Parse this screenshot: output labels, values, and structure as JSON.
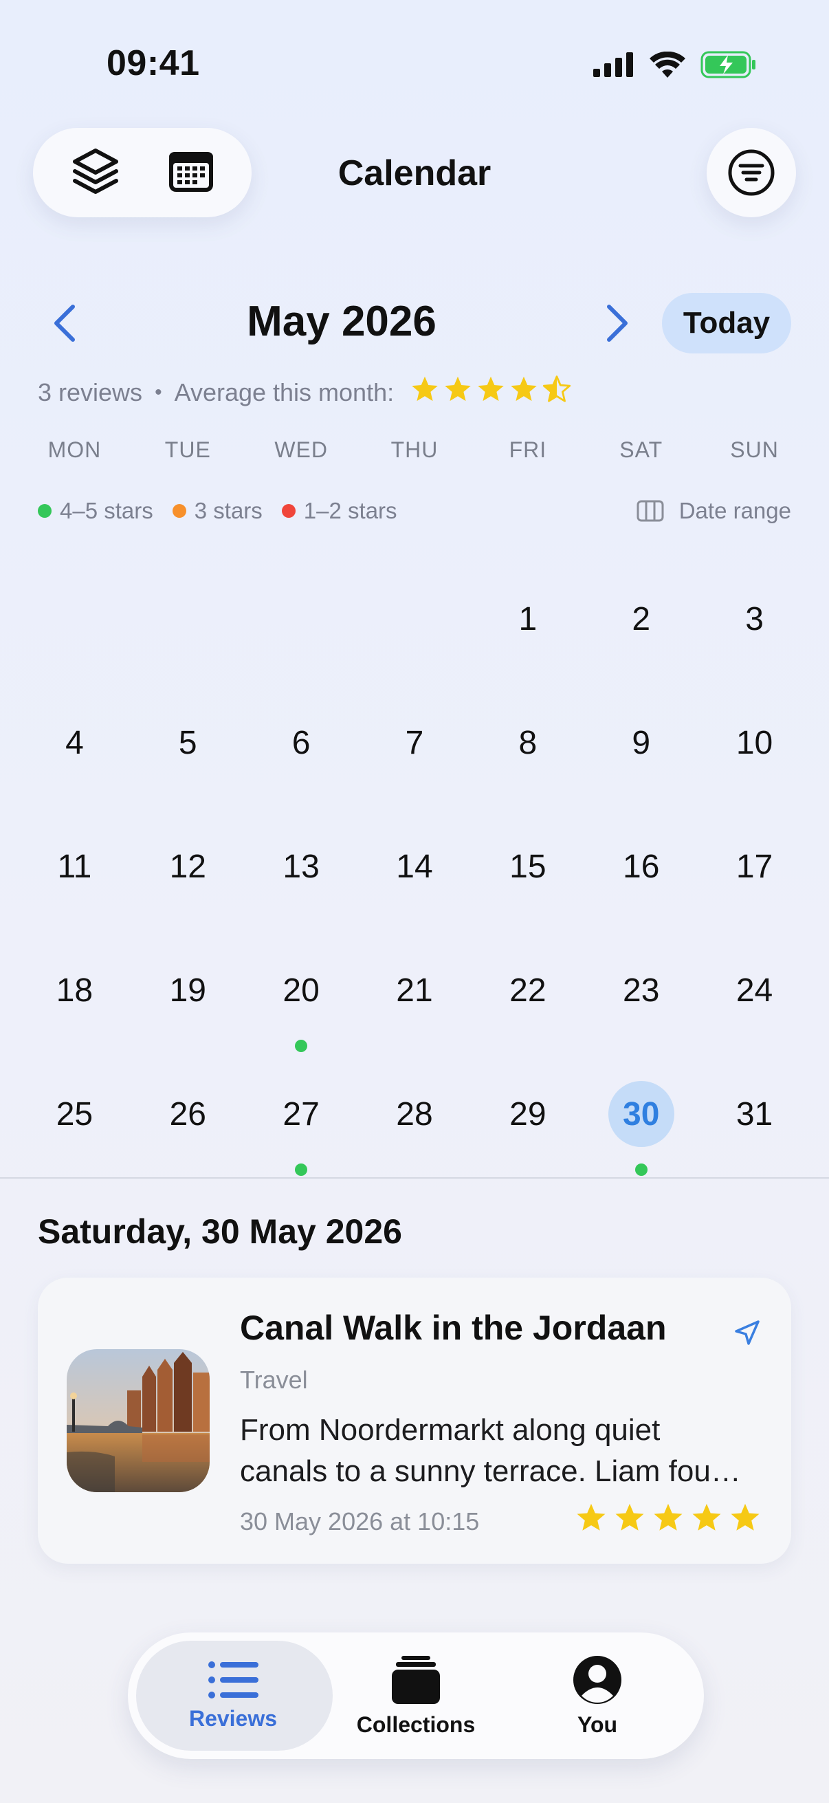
{
  "status_bar": {
    "time": "09:41"
  },
  "header": {
    "title": "Calendar",
    "left_icons": [
      "layers-icon",
      "calendar-icon"
    ],
    "right_icon": "filter-icon"
  },
  "month_nav": {
    "month_label": "May 2026",
    "today_label": "Today"
  },
  "summary": {
    "reviews_count": "3 reviews",
    "separator": "•",
    "average_label": "Average this month:",
    "average_rating": 4.5
  },
  "weekdays": [
    "MON",
    "TUE",
    "WED",
    "THU",
    "FRI",
    "SAT",
    "SUN"
  ],
  "legend": {
    "items": [
      {
        "label": "4–5 stars",
        "color": "#34c759"
      },
      {
        "label": "3 stars",
        "color": "#f7902b"
      },
      {
        "label": "1–2 stars",
        "color": "#f0453a"
      }
    ],
    "date_range_label": "Date range"
  },
  "calendar": {
    "leading_blanks": 4,
    "days": [
      "1",
      "2",
      "3",
      "4",
      "5",
      "6",
      "7",
      "8",
      "9",
      "10",
      "11",
      "12",
      "13",
      "14",
      "15",
      "16",
      "17",
      "18",
      "19",
      "20",
      "21",
      "22",
      "23",
      "24",
      "25",
      "26",
      "27",
      "28",
      "29",
      "30",
      "31"
    ],
    "selected_day": "30",
    "review_days": [
      "20",
      "27",
      "30"
    ]
  },
  "selected_date": {
    "title": "Saturday, 30 May 2026"
  },
  "review_card": {
    "title": "Canal Walk in the Jordaan",
    "category": "Travel",
    "description_line1": "From Noordermarkt along quiet",
    "description_line2": "canals to a sunny terrace. Liam fou…",
    "date": "30 May 2026 at 10:15",
    "rating": 5,
    "nav_icon": "location-arrow-icon"
  },
  "tabbar": {
    "tabs": [
      {
        "label": "Reviews",
        "icon": "list-icon",
        "active": true
      },
      {
        "label": "Collections",
        "icon": "stack-icon",
        "active": false
      },
      {
        "label": "You",
        "icon": "person-icon",
        "active": false
      }
    ]
  },
  "colors": {
    "accent": "#2f7fe0",
    "star": "#f6c915",
    "green_dot": "#34c759"
  }
}
